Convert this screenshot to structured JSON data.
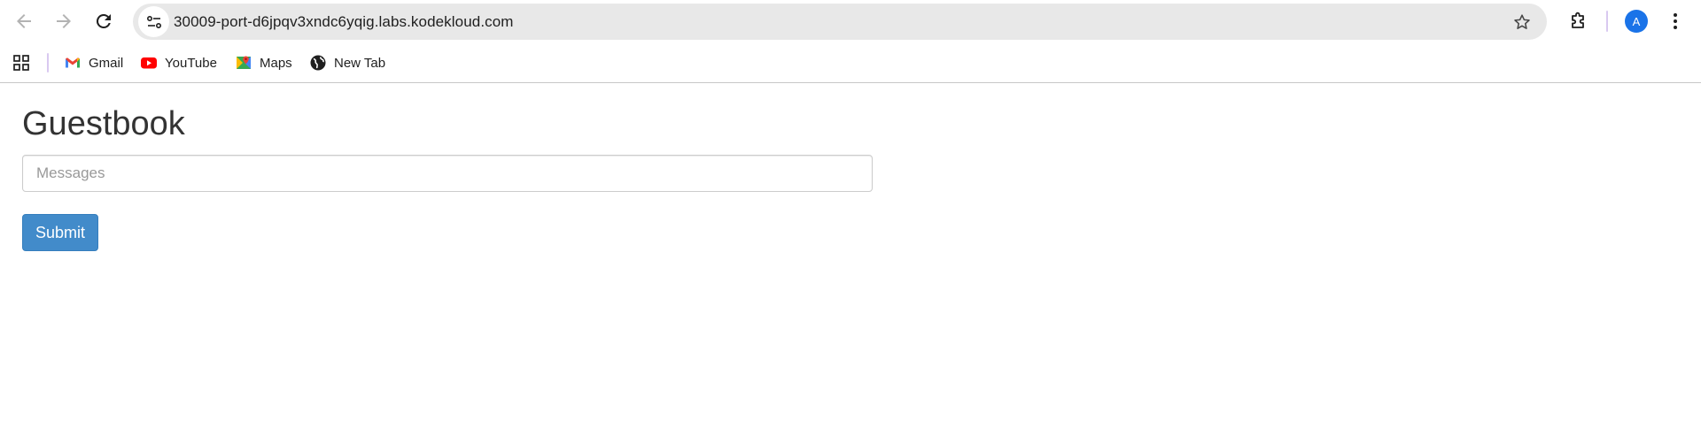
{
  "browser": {
    "url": "30009-port-d6jpqv3xndc6yqig.labs.kodekloud.com",
    "profile_initial": "A",
    "accent_color": "#1a73e8",
    "icons": {
      "back": "arrow-left-icon",
      "forward": "arrow-right-icon",
      "reload": "reload-icon",
      "site_info": "tune-icon",
      "bookmark": "star-icon",
      "extensions": "puzzle-icon",
      "menu": "three-dots-icon"
    }
  },
  "bookmarks": {
    "apps_icon": "grid-icon",
    "items": [
      {
        "label": "Gmail",
        "icon": "gmail-icon"
      },
      {
        "label": "YouTube",
        "icon": "youtube-icon"
      },
      {
        "label": "Maps",
        "icon": "maps-icon"
      },
      {
        "label": "New Tab",
        "icon": "globe-icon"
      }
    ]
  },
  "page": {
    "title": "Guestbook",
    "messages_placeholder": "Messages",
    "messages_value": "",
    "submit_label": "Submit",
    "button_color": "#428bca"
  }
}
